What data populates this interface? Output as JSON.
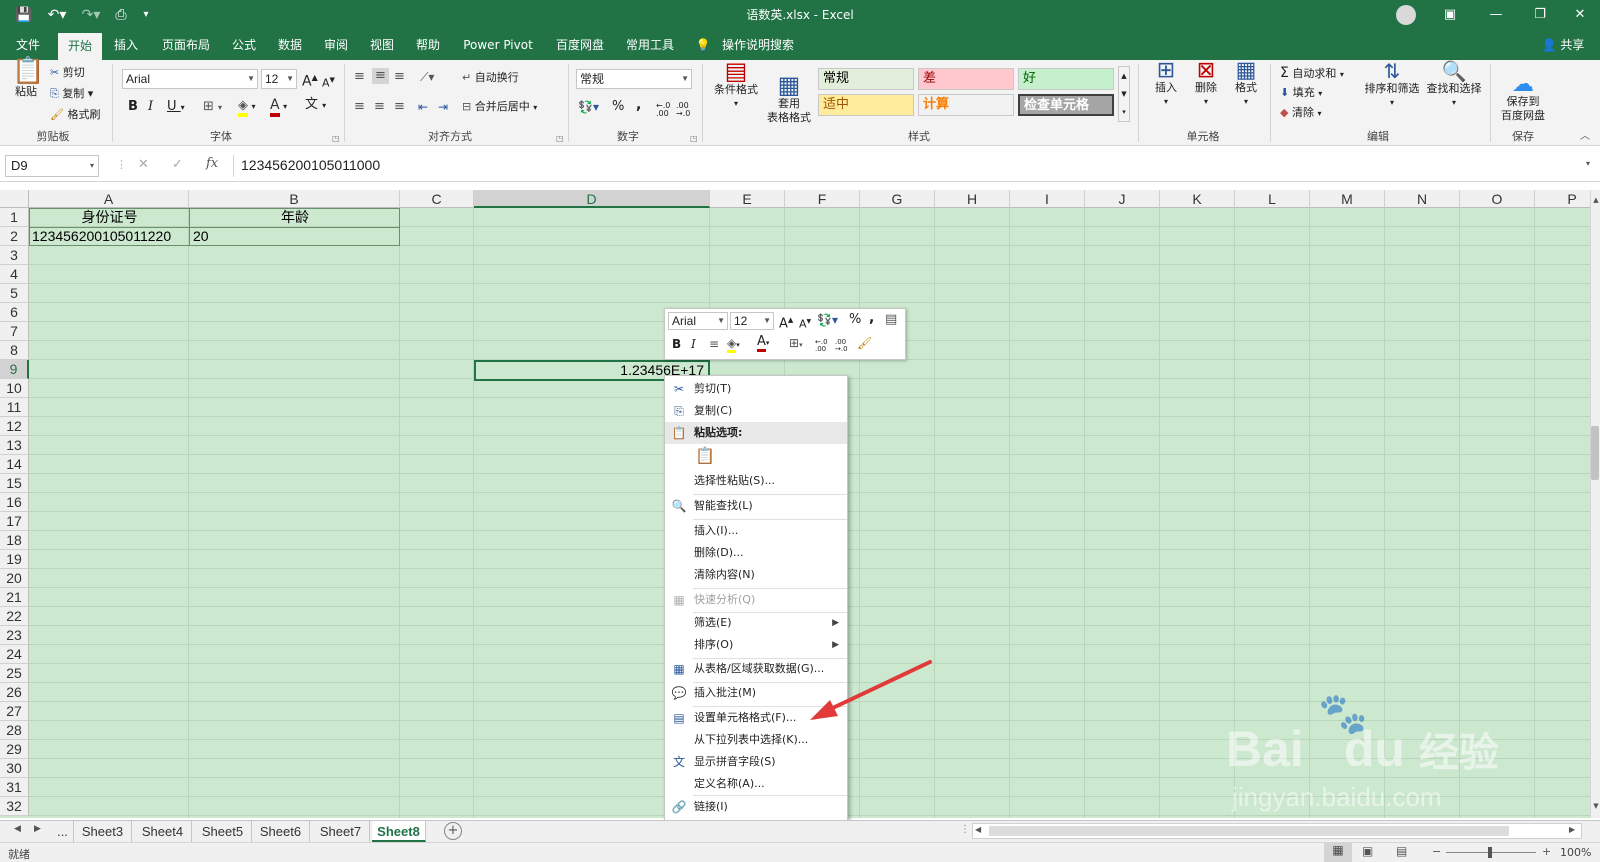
{
  "titlebar": {
    "title": "语数英.xlsx  -  Excel",
    "save_icon": "save-icon",
    "undo_icon": "undo-icon",
    "redo_icon": "redo-icon",
    "preview_icon": "print-preview-icon",
    "customize_icon": "customize-qat-icon"
  },
  "ribbon_tabs": [
    "文件",
    "开始",
    "插入",
    "页面布局",
    "公式",
    "数据",
    "审阅",
    "视图",
    "帮助",
    "Power Pivot",
    "百度网盘",
    "常用工具",
    "操作说明搜索"
  ],
  "share_label": "共享",
  "clipboard": {
    "paste": "粘贴",
    "cut": "剪切",
    "copy": "复制",
    "format_painter": "格式刷",
    "group": "剪贴板"
  },
  "font": {
    "name": "Arial",
    "size": "12",
    "group": "字体",
    "bold": "B",
    "italic": "I",
    "underline": "U",
    "grow": "A",
    "shrink": "A",
    "font_color": "A",
    "phonetic": "文"
  },
  "alignment": {
    "wrap": "自动换行",
    "merge": "合并后居中",
    "group": "对齐方式"
  },
  "number": {
    "format": "常规",
    "percent": "%",
    "comma": ",",
    "group": "数字",
    "increase_decimal": ".00",
    "decrease_decimal": ".00"
  },
  "styles": {
    "conditional": "条件格式",
    "table_format": "套用\n表格格式",
    "group": "样式",
    "cells": [
      {
        "label": "常规",
        "bg": "#e2efda",
        "fg": "#000000"
      },
      {
        "label": "差",
        "bg": "#ffc7ce",
        "fg": "#9c0006"
      },
      {
        "label": "好",
        "bg": "#c6efce",
        "fg": "#006100"
      },
      {
        "label": "适中",
        "bg": "#ffeb9c",
        "fg": "#9c5700"
      },
      {
        "label": "计算",
        "bg": "#f2f2f2",
        "fg": "#fa7d00"
      },
      {
        "label": "检查单元格",
        "bg": "#a5a5a5",
        "fg": "#ffffff"
      }
    ]
  },
  "cells_group": {
    "insert": "插入",
    "delete": "删除",
    "format": "格式",
    "group": "单元格"
  },
  "editing": {
    "autosum": "自动求和",
    "fill": "填充",
    "clear": "清除",
    "sort": "排序和筛选",
    "find": "查找和选择",
    "group": "编辑"
  },
  "save_group": {
    "save": "保存到\n百度网盘",
    "group": "保存"
  },
  "formula_bar": {
    "name_box": "D9",
    "cancel": "✕",
    "enter": "✓",
    "fx": "fx",
    "value": "123456200105011000"
  },
  "columns": [
    "A",
    "B",
    "C",
    "D",
    "E",
    "F",
    "G",
    "H",
    "I",
    "J",
    "K",
    "L",
    "M",
    "N",
    "O",
    "P"
  ],
  "rows": [
    "1",
    "2",
    "3",
    "4",
    "5",
    "6",
    "7",
    "8",
    "9",
    "10",
    "11",
    "12",
    "13",
    "14",
    "15",
    "16",
    "17",
    "18",
    "19",
    "20",
    "21",
    "22",
    "23",
    "24",
    "25",
    "26",
    "27",
    "28",
    "29",
    "30",
    "31",
    "32"
  ],
  "cells": {
    "A1": "身份证号",
    "B1": "年龄",
    "A2": "123456200105011220",
    "B2": "20",
    "D9": "1.23456E+17"
  },
  "mini_toolbar": {
    "font": "Arial",
    "size": "12",
    "grow": "A",
    "shrink": "A",
    "percent": "%",
    "comma": ",",
    "bold": "B",
    "italic": "I",
    "font_color": "A"
  },
  "context_menu": {
    "items": [
      {
        "label": "剪切(T)",
        "icon": "cut-icon",
        "glyph": "✂"
      },
      {
        "label": "复制(C)",
        "icon": "copy-icon",
        "glyph": "⎘"
      },
      {
        "label": "粘贴选项:",
        "icon": "paste-icon",
        "glyph": "📋"
      },
      {
        "label": "选择性粘贴(S)..."
      },
      {
        "label": "智能查找(L)",
        "icon": "smart-lookup-icon",
        "glyph": "🔍"
      },
      {
        "label": "插入(I)..."
      },
      {
        "label": "删除(D)..."
      },
      {
        "label": "清除内容(N)"
      },
      {
        "label": "快速分析(Q)",
        "icon": "quick-analysis-icon",
        "glyph": "▦"
      },
      {
        "label": "筛选(E)"
      },
      {
        "label": "排序(O)"
      },
      {
        "label": "从表格/区域获取数据(G)...",
        "icon": "table-icon",
        "glyph": "▦"
      },
      {
        "label": "插入批注(M)",
        "icon": "comment-icon",
        "glyph": "💬"
      },
      {
        "label": "设置单元格格式(F)...",
        "icon": "format-cells-icon",
        "glyph": "▤"
      },
      {
        "label": "从下拉列表中选择(K)..."
      },
      {
        "label": "显示拼音字段(S)",
        "icon": "phonetic-icon",
        "glyph": "文"
      },
      {
        "label": "定义名称(A)..."
      },
      {
        "label": "链接(I)",
        "icon": "link-icon",
        "glyph": "🔗"
      }
    ]
  },
  "sheets": [
    "...",
    "Sheet3",
    "Sheet4",
    "Sheet5",
    "Sheet6",
    "Sheet7",
    "Sheet8"
  ],
  "active_sheet": "Sheet8",
  "status": {
    "ready": "就绪",
    "zoom": "100%"
  },
  "watermark": {
    "brand": "Bai",
    "brand2": "du",
    "cn": "经验",
    "url": "jingyan.baidu.com"
  }
}
